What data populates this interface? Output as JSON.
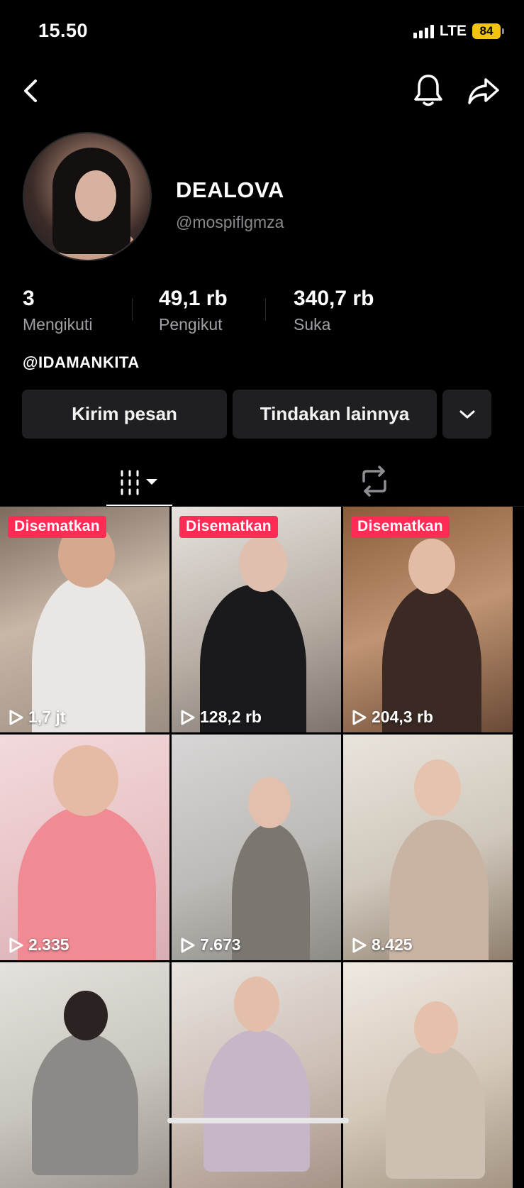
{
  "status_bar": {
    "time": "15.50",
    "network": "LTE",
    "battery": "84"
  },
  "profile": {
    "display_name": "DEALOVA",
    "handle": "@mospiflgmza",
    "bio": "@IDAMANKITA"
  },
  "stats": [
    {
      "value": "3",
      "label": "Mengikuti"
    },
    {
      "value": "49,1 rb",
      "label": "Pengikut"
    },
    {
      "value": "340,7 rb",
      "label": "Suka"
    }
  ],
  "actions": {
    "message": "Kirim pesan",
    "more": "Tindakan lainnya"
  },
  "videos": [
    {
      "views": "1,7 jt",
      "pinned": "Disematkan"
    },
    {
      "views": "128,2 rb",
      "pinned": "Disematkan"
    },
    {
      "views": "204,3 rb",
      "pinned": "Disematkan"
    },
    {
      "views": "2.335"
    },
    {
      "views": "7.673"
    },
    {
      "views": "8.425"
    },
    {
      "views": ""
    },
    {
      "views": ""
    },
    {
      "views": ""
    }
  ],
  "colors": {
    "accent": "#fe2c55",
    "button_bg": "#1f1f21",
    "battery": "#f1c40f"
  },
  "icons": [
    "back-icon",
    "bell-icon",
    "share-icon",
    "grid-icon",
    "repost-icon",
    "play-icon",
    "chevron-down-icon"
  ]
}
